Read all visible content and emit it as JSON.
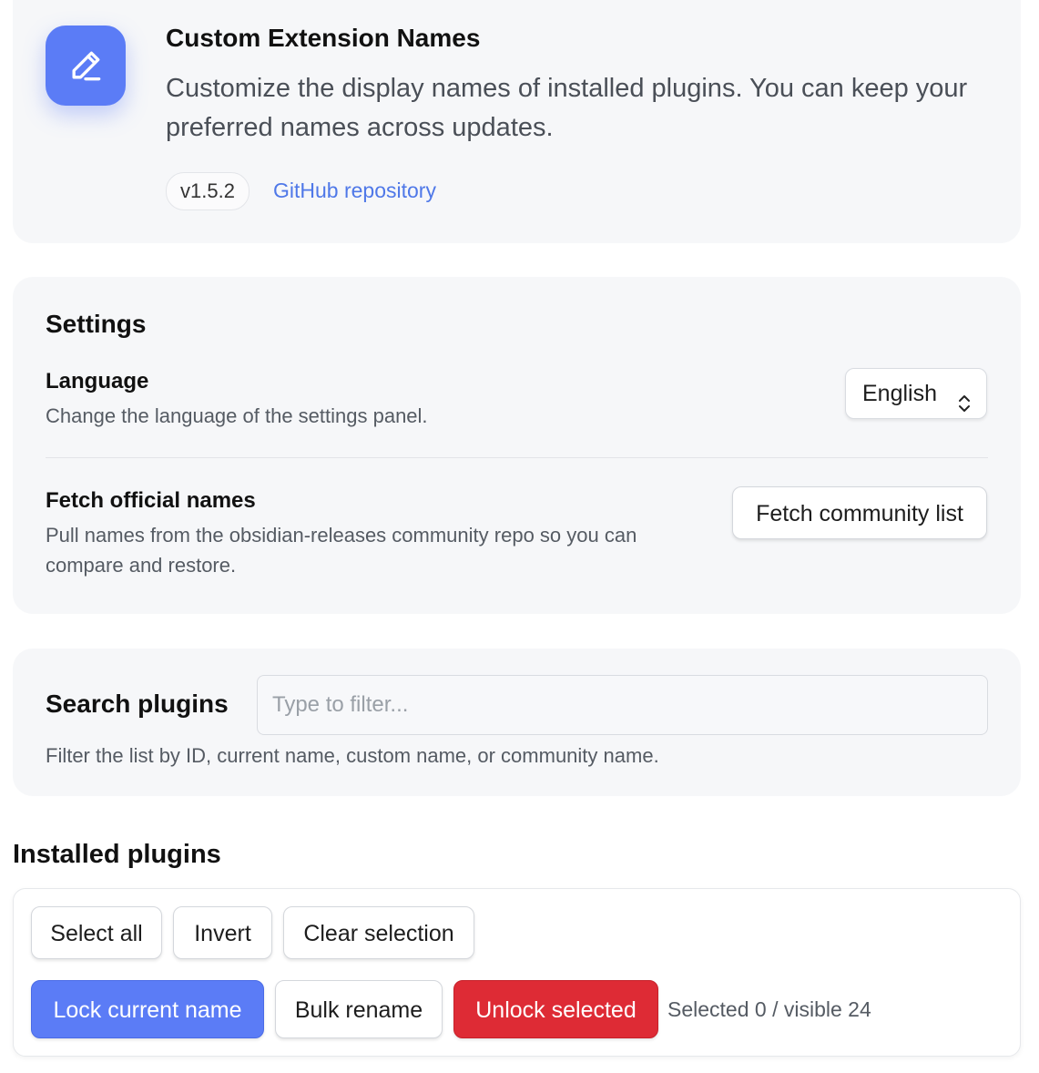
{
  "header": {
    "title": "Custom Extension Names",
    "description": "Customize the display names of installed plugins. You can keep your preferred names across updates.",
    "version": "v1.5.2",
    "github_link": "GitHub repository",
    "icon": "pencil-icon",
    "accent_color": "#5b7cf6"
  },
  "settings": {
    "title": "Settings",
    "language": {
      "name": "Language",
      "description": "Change the language of the settings panel.",
      "selected": "English"
    },
    "fetch": {
      "name": "Fetch official names",
      "description": "Pull names from the obsidian-releases community repo so you can compare and restore.",
      "button": "Fetch community list"
    }
  },
  "search": {
    "label": "Search plugins",
    "placeholder": "Type to filter...",
    "hint": "Filter the list by ID, current name, custom name, or community name."
  },
  "installed": {
    "title": "Installed plugins",
    "buttons": {
      "select_all": "Select all",
      "invert": "Invert",
      "clear": "Clear selection",
      "lock": "Lock current name",
      "bulk_rename": "Bulk rename",
      "unlock": "Unlock selected"
    },
    "selection_status": "Selected 0 / visible 24",
    "primary_color": "#5b7cf6",
    "danger_color": "#de2b35"
  }
}
